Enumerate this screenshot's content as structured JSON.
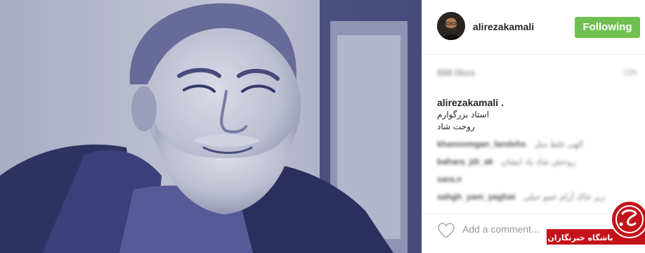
{
  "header": {
    "username": "alirezakamali",
    "follow_label": "Following"
  },
  "stats": {
    "likes": "898 likes",
    "time_ago": "10h"
  },
  "caption": {
    "username": "alirezakamali .",
    "lines": [
      "استاد بزرگوارم",
      "روحت شاد"
    ]
  },
  "comments": [
    {
      "user": "khanoomgan_landehs",
      "text": "الهی غلط مثل"
    },
    {
      "user": "bahara_jdi_ak",
      "text": "روحش شاد یاد ایشان"
    },
    {
      "user": "sara.n",
      "text": ""
    },
    {
      "user": "sahgh_yam_yaghat",
      "text": "زیر خاک آرام عمو خیلی"
    }
  ],
  "actions": {
    "add_comment_placeholder": "Add a comment..."
  },
  "watermark": {
    "text": "باشگاه خبرنگاران"
  },
  "colors": {
    "follow_green": "#70c050",
    "photo_tint": "#3c3f86",
    "watermark_red": "#c4121a"
  }
}
